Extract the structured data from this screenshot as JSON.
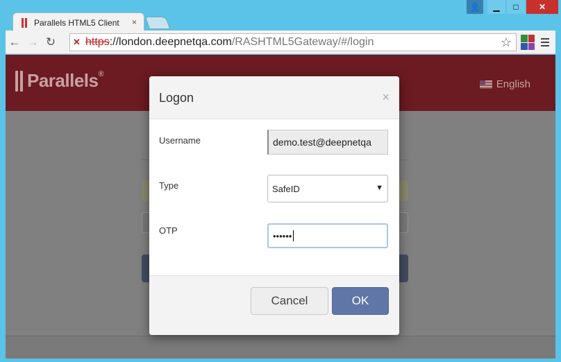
{
  "window": {
    "controls": {
      "minimize": "▁",
      "maximize": "□",
      "close": "✕"
    }
  },
  "browser": {
    "tab_title": "Parallels HTML5 Client",
    "tab_close": "×",
    "url_scheme": "https",
    "url_sep": "://",
    "url_host": "london.deepnetqa.com",
    "url_path": "/RASHTML5Gateway/#/login",
    "back": "←",
    "forward": "→",
    "reload": "↻",
    "star": "☆"
  },
  "page": {
    "brand": "Parallels",
    "brand_reg": "®",
    "language": "English",
    "header_color": "#6b1b21"
  },
  "modal": {
    "title": "Logon",
    "close": "×",
    "username_label": "Username",
    "username_value": "demo.test@deepnetqa",
    "type_label": "Type",
    "type_value": "SafeID",
    "type_caret": "▼",
    "otp_label": "OTP",
    "otp_value": "••••••",
    "cancel_label": "Cancel",
    "ok_label": "OK"
  }
}
